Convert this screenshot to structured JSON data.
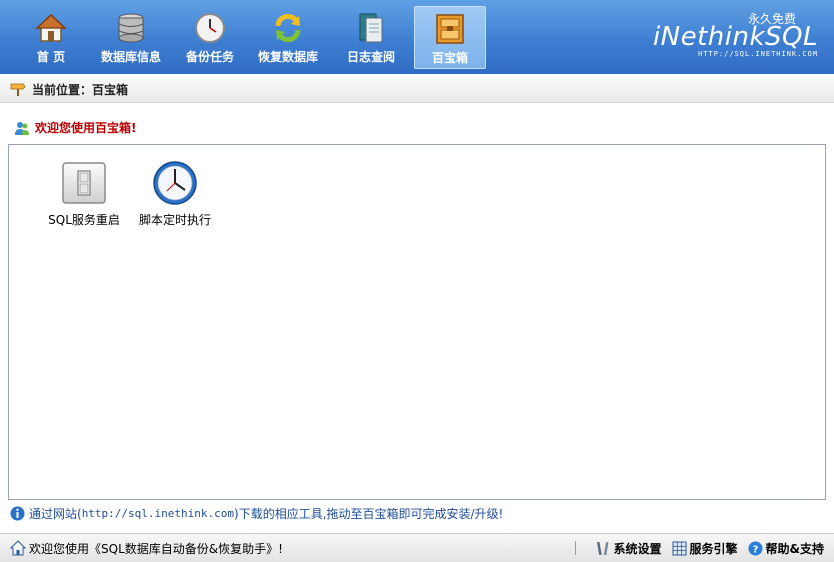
{
  "nav": {
    "items": [
      {
        "label": "首 页",
        "icon": "home-icon"
      },
      {
        "label": "数据库信息",
        "icon": "database-icon"
      },
      {
        "label": "备份任务",
        "icon": "clock-icon"
      },
      {
        "label": "恢复数据库",
        "icon": "refresh-icon"
      },
      {
        "label": "日志查阅",
        "icon": "log-book-icon"
      },
      {
        "label": "百宝箱",
        "icon": "toolbox-icon"
      }
    ],
    "active_index": 5
  },
  "brand": {
    "free_label": "永久免费",
    "logo": "iNethinkSQL",
    "url": "HTTP://SQL.INETHINK.COM"
  },
  "breadcrumb": {
    "text": "当前位置：百宝箱"
  },
  "welcome": {
    "text": "欢迎您使用百宝箱!"
  },
  "tools": [
    {
      "label": "SQL服务重启",
      "icon": "switch-icon"
    },
    {
      "label": "脚本定时执行",
      "icon": "clock-icon"
    }
  ],
  "info": {
    "prefix": "通过网站(",
    "url": "http://sql.inethink.com",
    "suffix": ")下载的相应工具,拖动至百宝箱即可完成安装/升级!"
  },
  "status": {
    "message": "欢迎您使用《SQL数据库自动备份&恢复助手》!",
    "links": [
      {
        "label": "系统设置",
        "icon": "tools-icon"
      },
      {
        "label": "服务引擎",
        "icon": "grid-icon"
      },
      {
        "label": "帮助&支持",
        "icon": "help-icon"
      }
    ]
  },
  "colors": {
    "toolbar_top": "#5fa0e4",
    "toolbar_bottom": "#2f6cc3",
    "welcome_text": "#b80000",
    "info_text": "#1f4e99"
  }
}
